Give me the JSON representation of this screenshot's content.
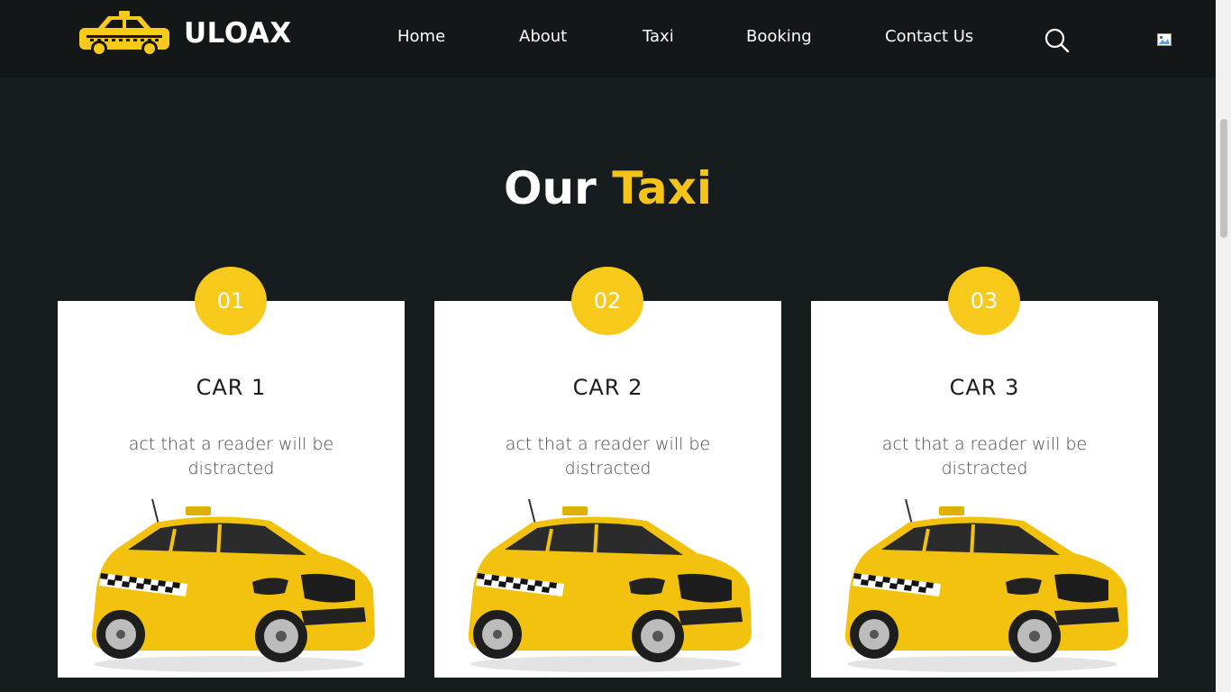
{
  "brand": {
    "name": "ULOAX",
    "logo_icon": "taxi-car-icon"
  },
  "nav": {
    "items": [
      {
        "label": "Home"
      },
      {
        "label": "About"
      },
      {
        "label": "Taxi"
      },
      {
        "label": "Booking"
      },
      {
        "label": "Contact Us"
      }
    ],
    "search_icon": "search-icon"
  },
  "section": {
    "title_main": "Our",
    "title_highlight": "Taxi"
  },
  "cards": [
    {
      "number": "01",
      "title": "CAR 1",
      "description": "act that a reader will be distracted"
    },
    {
      "number": "02",
      "title": "CAR 2",
      "description": "act that a reader will be distracted"
    },
    {
      "number": "03",
      "title": "CAR 3",
      "description": "act that a reader will be distracted"
    }
  ],
  "colors": {
    "accent": "#f6c91b",
    "background": "#171c1f",
    "navbar": "#141718"
  }
}
